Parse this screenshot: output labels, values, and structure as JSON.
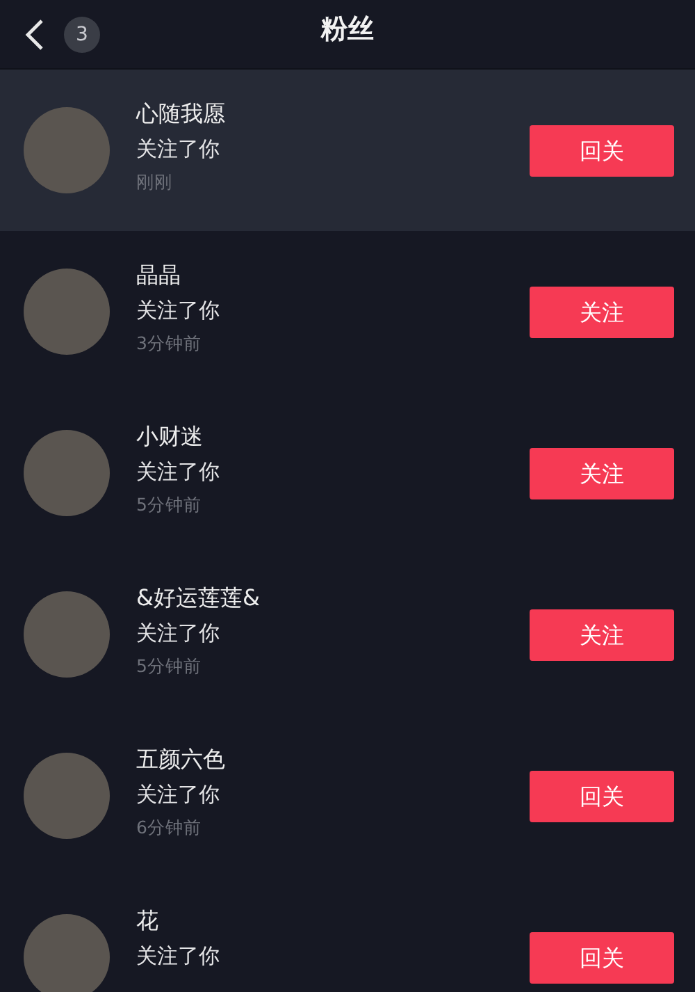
{
  "header": {
    "back_badge": "3",
    "title": "粉丝"
  },
  "followers": [
    {
      "name": "心随我愿",
      "action": "关注了你",
      "time": "刚刚",
      "button": "回关",
      "highlighted": true
    },
    {
      "name": "晶晶",
      "action": "关注了你",
      "time": "3分钟前",
      "button": "关注",
      "highlighted": false
    },
    {
      "name": "小财迷",
      "action": "关注了你",
      "time": "5分钟前",
      "button": "关注",
      "highlighted": false
    },
    {
      "name": "&好运莲莲&",
      "action": "关注了你",
      "time": "5分钟前",
      "button": "关注",
      "highlighted": false
    },
    {
      "name": "五颜六色",
      "action": "关注了你",
      "time": "6分钟前",
      "button": "回关",
      "highlighted": false
    },
    {
      "name": "花",
      "action": "关注了你",
      "button": "回关",
      "highlighted": false
    }
  ]
}
